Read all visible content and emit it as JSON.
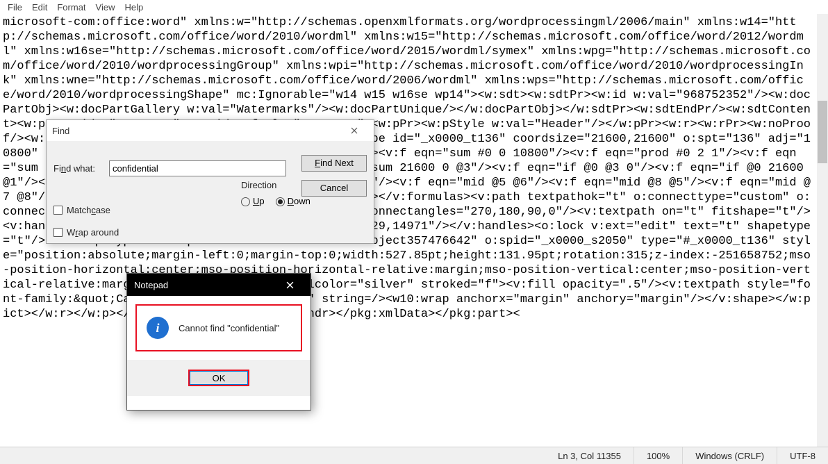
{
  "menubar": {
    "items": [
      "File",
      "Edit",
      "Format",
      "View",
      "Help"
    ]
  },
  "editor": {
    "text": "microsoft-com:office:word\" xmlns:w=\"http://schemas.openxmlformats.org/wordprocessingml/2006/main\" xmlns:w14=\"http://schemas.microsoft.com/office/word/2010/wordml\" xmlns:w15=\"http://schemas.microsoft.com/office/word/2012/wordml\" xmlns:w16se=\"http://schemas.microsoft.com/office/word/2015/wordml/symex\" xmlns:wpg=\"http://schemas.microsoft.com/office/word/2010/wordprocessingGroup\" xmlns:wpi=\"http://schemas.microsoft.com/office/word/2010/wordprocessingInk\" xmlns:wne=\"http://schemas.microsoft.com/office/word/2006/wordml\" xmlns:wps=\"http://schemas.microsoft.com/office/word/2010/wordprocessingShape\" mc:Ignorable=\"w14 w15 w16se wp14\"><w:sdt><w:sdtPr><w:id w:val=\"968752352\"/><w:docPartObj><w:docPartGallery w:val=\"Watermarks\"/><w:docPartUnique/></w:docPartObj></w:sdtPr><w:sdtEndPr/><w:sdtContent><w:p w:rsidR=\"002940B5\" w:rsidRDefault=\"00DF6AE8\"><w:pPr><w:pStyle w:val=\"Header\"/></w:pPr><w:r><w:rPr><w:noProof/><w:lang w:val=\"en-US\"/></w:rPr><w:pict><v:shapetype id=\"_x0000_t136\" coordsize=\"21600,21600\" o:spt=\"136\" adj=\"10800\" path=\"m@7,l@8,m@5,21600l@6,21600e\"><v:formulas><v:f eqn=\"sum #0 0 10800\"/><v:f eqn=\"prod #0 2 1\"/><v:f eqn=\"sum 21600 0 @1\"/><v:f eqn=\"sum 0 0 @2\"/><v:f eqn=\"sum 21600 0 @3\"/><v:f eqn=\"if @0 @3 0\"/><v:f eqn=\"if @0 21600 @1\"/><v:f eqn=\"if @0 0 @2\"/><v:f eqn=\"if @0 @4 21600\"/><v:f eqn=\"mid @5 @6\"/><v:f eqn=\"mid @8 @5\"/><v:f eqn=\"mid @7 @8\"/><v:f eqn=\"mid @6 @7\"/><v:f eqn=\"sum @6 0 @5\"/></v:formulas><v:path textpathok=\"t\" o:connecttype=\"custom\" o:connectlocs=\"@9,0;@10,10800;@11,21600;@12,10800\" o:connectangles=\"270,180,90,0\"/><v:textpath on=\"t\" fitshape=\"t\"/><v:handles><v:h position=\"#0,bottomRight\" xrange=\"6629,14971\"/></v:handles><o:lock v:ext=\"edit\" text=\"t\" shapetype=\"t\"/></v:shapetype><v:shape id=\"PowerPlusWaterMarkObject357476642\" o:spid=\"_x0000_s2050\" type=\"#_x0000_t136\" style=\"position:absolute;margin-left:0;margin-top:0;width:527.85pt;height:131.95pt;rotation:315;z-index:-251658752;mso-position-horizontal:center;mso-position-horizontal-relative:margin;mso-position-vertical:center;mso-position-vertical-relative:margin\" o:allowincell=\"f\" fillcolor=\"silver\" stroked=\"f\"><v:fill opacity=\".5\"/><v:textpath style=\"font-family:&quot;Calibri&quot;;font-size:1pt\" string=/><w10:wrap anchorx=\"margin\" anchory=\"margin\"/></v:shape></w:pict></w:r></w:p></w:sdtContent></w:sdt></w:hdr></pkg:xmlData></pkg:part><"
  },
  "find": {
    "title": "Find",
    "find_what_label": "Find what:",
    "find_what_value": "confidential",
    "find_next": "Find Next",
    "find_next_u": "F",
    "cancel": "Cancel",
    "direction_label": "Direction",
    "up": "Up",
    "down": "Down",
    "direction_selected": "down",
    "match_case": "Match case",
    "wrap_around": "Wrap around"
  },
  "msgbox": {
    "title": "Notepad",
    "text": "Cannot find \"confidential\"",
    "ok": "OK",
    "icon": "info-icon"
  },
  "status": {
    "pos": "Ln 3, Col 11355",
    "zoom": "100%",
    "eol": "Windows (CRLF)",
    "encoding": "UTF-8"
  }
}
